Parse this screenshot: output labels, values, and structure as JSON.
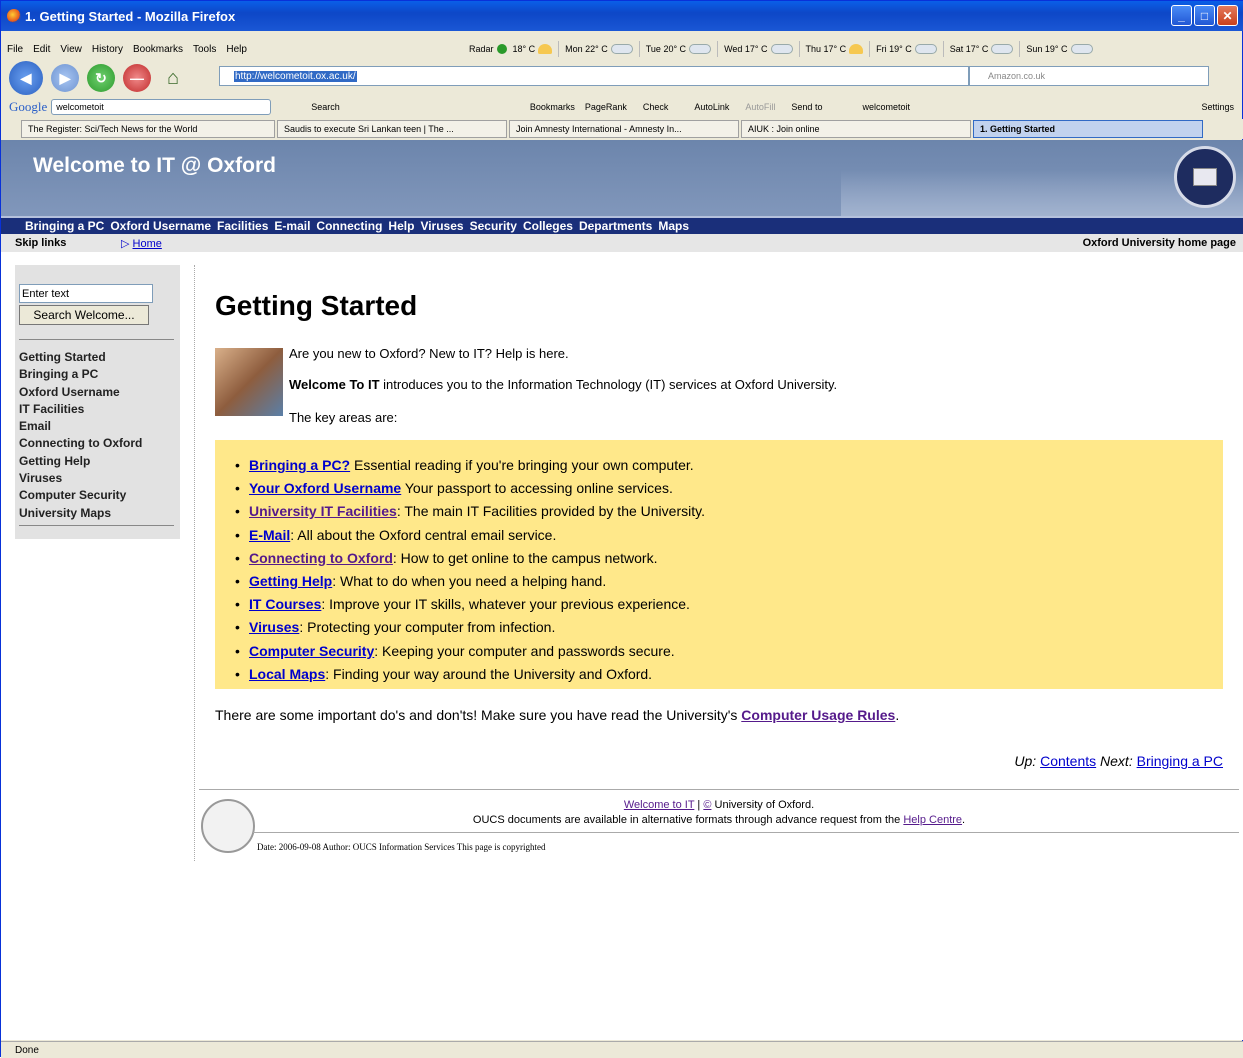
{
  "window": {
    "title": "1. Getting Started - Mozilla Firefox"
  },
  "menu": [
    "File",
    "Edit",
    "View",
    "History",
    "Bookmarks",
    "Tools",
    "Help"
  ],
  "weather": {
    "radar": "Radar",
    "now": "18° C",
    "days": [
      "Mon 22° C",
      "Tue 20° C",
      "Wed 17° C",
      "Thu 17° C",
      "Fri 19° C",
      "Sat 17° C",
      "Sun 19° C"
    ]
  },
  "nav": {
    "url": "http://welcometoit.ox.ac.uk/",
    "search_placeholder": "Amazon.co.uk"
  },
  "google": {
    "logo": "Google",
    "query": "welcometoit",
    "items": [
      "Search",
      "Bookmarks",
      "PageRank",
      "Check",
      "AutoLink",
      "AutoFill",
      "Send to",
      "welcometoit"
    ],
    "settings": "Settings"
  },
  "tabs": [
    "The Register: Sci/Tech News for the World",
    "Saudis to execute Sri Lankan teen | The ...",
    "Join Amnesty International - Amnesty In...",
    "AIUK : Join online",
    "1. Getting Started"
  ],
  "site": {
    "banner_title": "Welcome to IT @ Oxford",
    "topnav": [
      "Bringing a PC",
      "Oxford Username",
      "Facilities",
      "E-mail",
      "Connecting",
      "Help",
      "Viruses",
      "Security",
      "Colleges",
      "Departments",
      "Maps"
    ],
    "skip_links": "Skip links",
    "home": "Home",
    "ox_home": "Oxford University home page",
    "search_placeholder": "Enter text",
    "search_button": "Search  Welcome...",
    "sidebar": [
      "Getting Started",
      "Bringing a PC",
      "Oxford Username",
      "IT Facilities",
      "Email",
      "Connecting to Oxford",
      "Getting Help",
      "Viruses",
      "Computer Security",
      "University Maps"
    ]
  },
  "page": {
    "title": "Getting Started",
    "intro1": "Are you new to Oxford? New to IT? Help is here.",
    "intro2_bold": "Welcome To IT",
    "intro2_rest": " introduces you to the Information Technology (IT) services at Oxford University.",
    "intro3": "The key areas are:",
    "key_areas": [
      {
        "link": "Bringing a PC?",
        "text": " Essential reading if you're bringing your own computer."
      },
      {
        "link": "Your Oxford Username",
        "text": " Your passport to accessing online services."
      },
      {
        "link": "University IT Facilities",
        "text": ": The main IT Facilities provided by the University."
      },
      {
        "link": "E-Mail",
        "text": ": All about the Oxford central email service."
      },
      {
        "link": "Connecting to Oxford",
        "text": ": How to get online to the campus network."
      },
      {
        "link": "Getting Help",
        "text": ": What to do when you need a helping hand."
      },
      {
        "link": "IT Courses",
        "text": ": Improve your IT skills, whatever your previous experience."
      },
      {
        "link": "Viruses",
        "text": ": Protecting your computer from infection."
      },
      {
        "link": "Computer Security",
        "text": ": Keeping your computer and passwords secure."
      },
      {
        "link": "Local Maps",
        "text": ": Finding your way around the University and Oxford."
      }
    ],
    "rules_text": "There are some important do's and don'ts! Make sure you have read the University's ",
    "rules_link": "Computer Usage Rules",
    "rules_end": ".",
    "up_label": "Up: ",
    "up_link": "Contents",
    "next_label": " Next: ",
    "next_link": "Bringing a PC"
  },
  "footer": {
    "line1_link": "Welcome to IT",
    "line1_sep": " | ",
    "line1_copy": "©",
    "line1_text": " University of Oxford.",
    "line2_text": "OUCS documents are available in alternative formats through advance request from the ",
    "line2_link": "Help Centre",
    "line2_end": ".",
    "date": "Date: 2006-09-08 Author: OUCS Information Services This page is copyrighted"
  },
  "status": "Done"
}
